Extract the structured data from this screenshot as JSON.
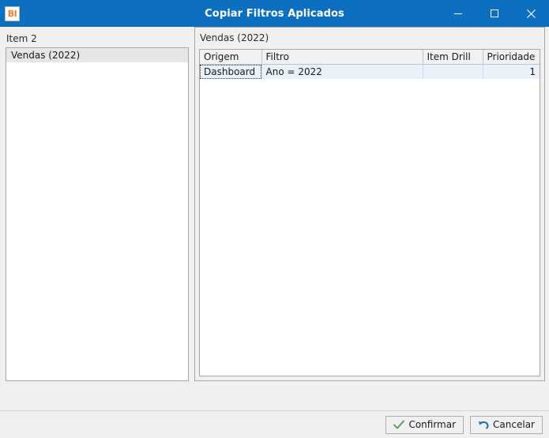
{
  "window": {
    "title": "Copiar Filtros Aplicados",
    "app_icon": "BI",
    "icon_name": "bi-app-icon",
    "accent_color": "#0c6fc0",
    "controls": [
      {
        "name": "minimize-button",
        "label": "Minimizar"
      },
      {
        "name": "maximize-button",
        "label": "Maximizar"
      },
      {
        "name": "close-button",
        "label": "Fechar"
      }
    ]
  },
  "left_pane": {
    "label": "Item 2",
    "items": [
      {
        "label": "Vendas (2022)",
        "selected": true
      }
    ]
  },
  "right_pane": {
    "title": "Vendas (2022)",
    "grid": {
      "columns": [
        "Origem",
        "Filtro",
        "Item Drill",
        "Prioridade"
      ],
      "rows": [
        {
          "Origem": "Dashboard",
          "Filtro": "Ano = 2022",
          "Item Drill": "",
          "Prioridade": "1"
        }
      ]
    }
  },
  "footer": {
    "confirm_label": "Confirmar",
    "cancel_label": "Cancelar",
    "confirm_icon": "check-icon",
    "cancel_icon": "undo-arrow-icon",
    "confirm_icon_color": "#4a9a52",
    "cancel_icon_color": "#1f6fb5"
  }
}
